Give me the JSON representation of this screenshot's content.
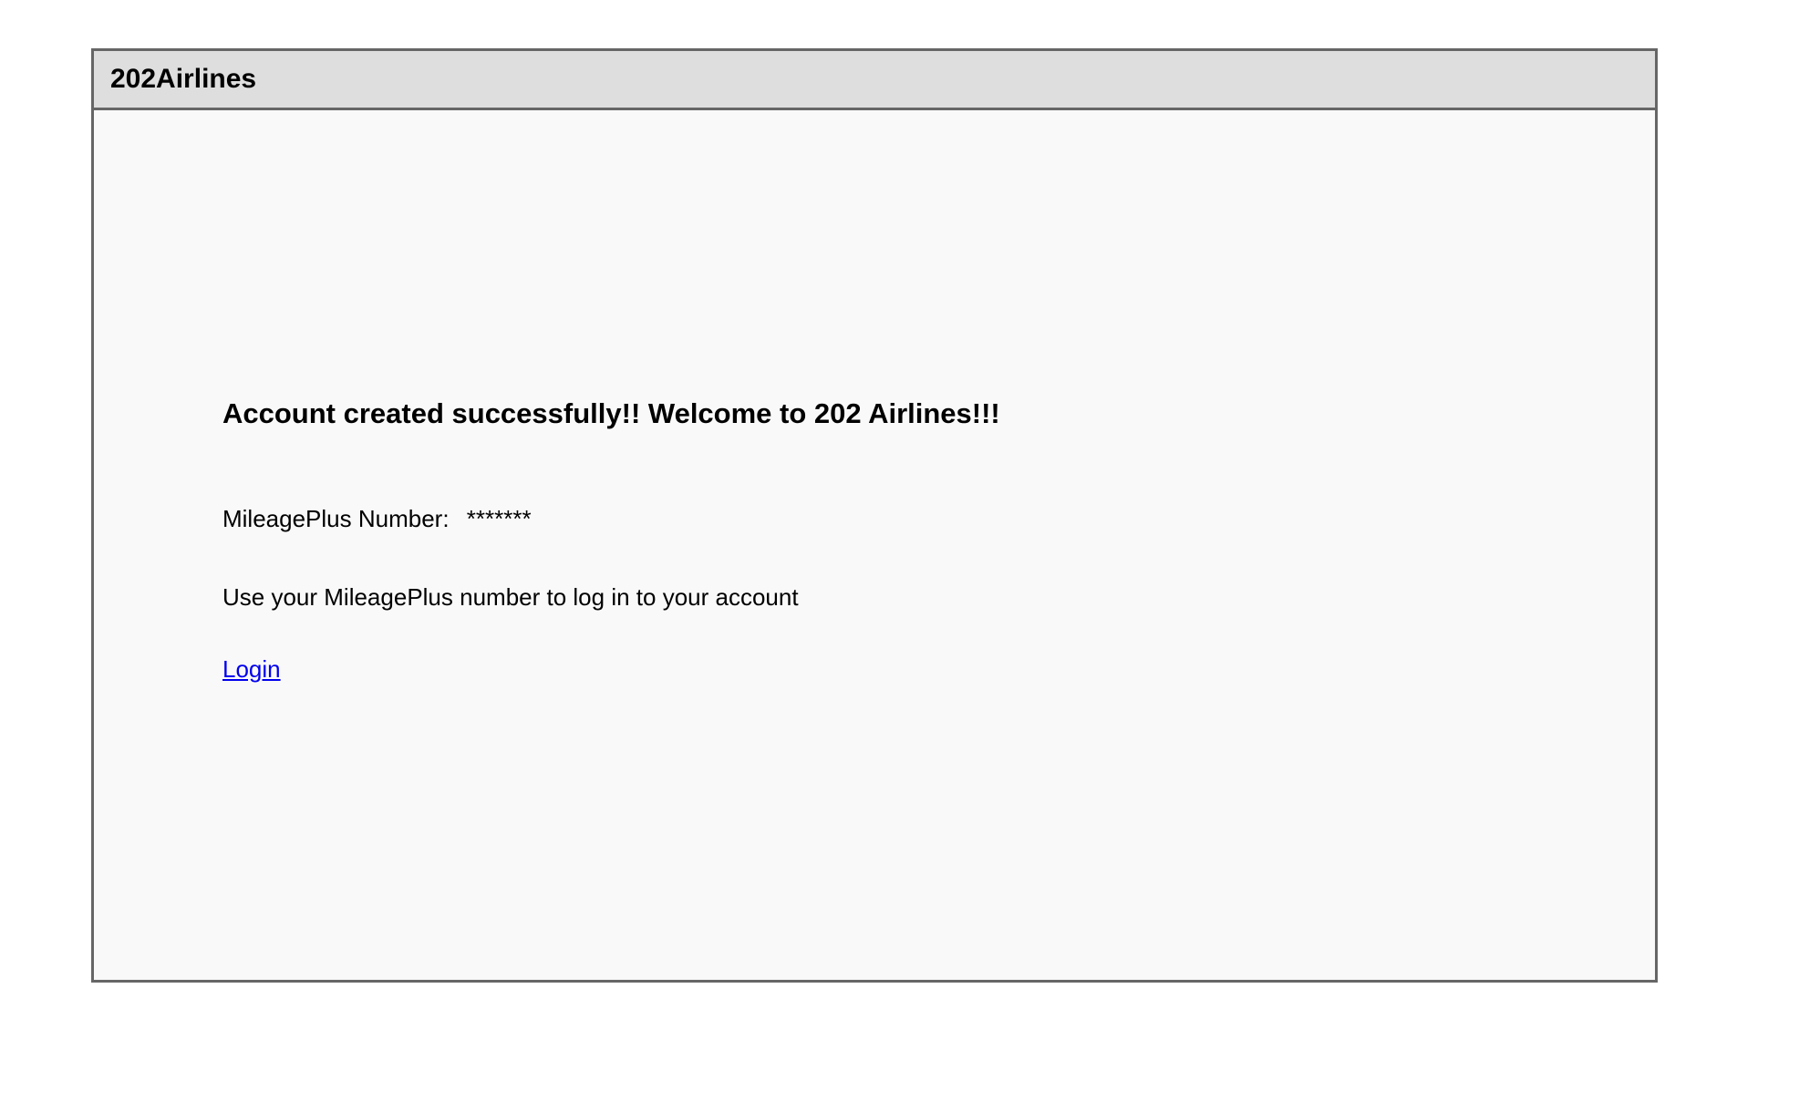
{
  "header": {
    "brand": "202Airlines"
  },
  "main": {
    "headline": "Account created successfully!! Welcome to 202 Airlines!!!",
    "mileage_label": "MileagePlus Number:",
    "mileage_value": "*******",
    "hint": "Use your MileagePlus number to log in to your account",
    "login_link": "Login"
  },
  "colors": {
    "frame_border": "#666666",
    "header_bg": "#dedede",
    "body_bg": "#f9f9f9",
    "link": "#0000ee"
  }
}
